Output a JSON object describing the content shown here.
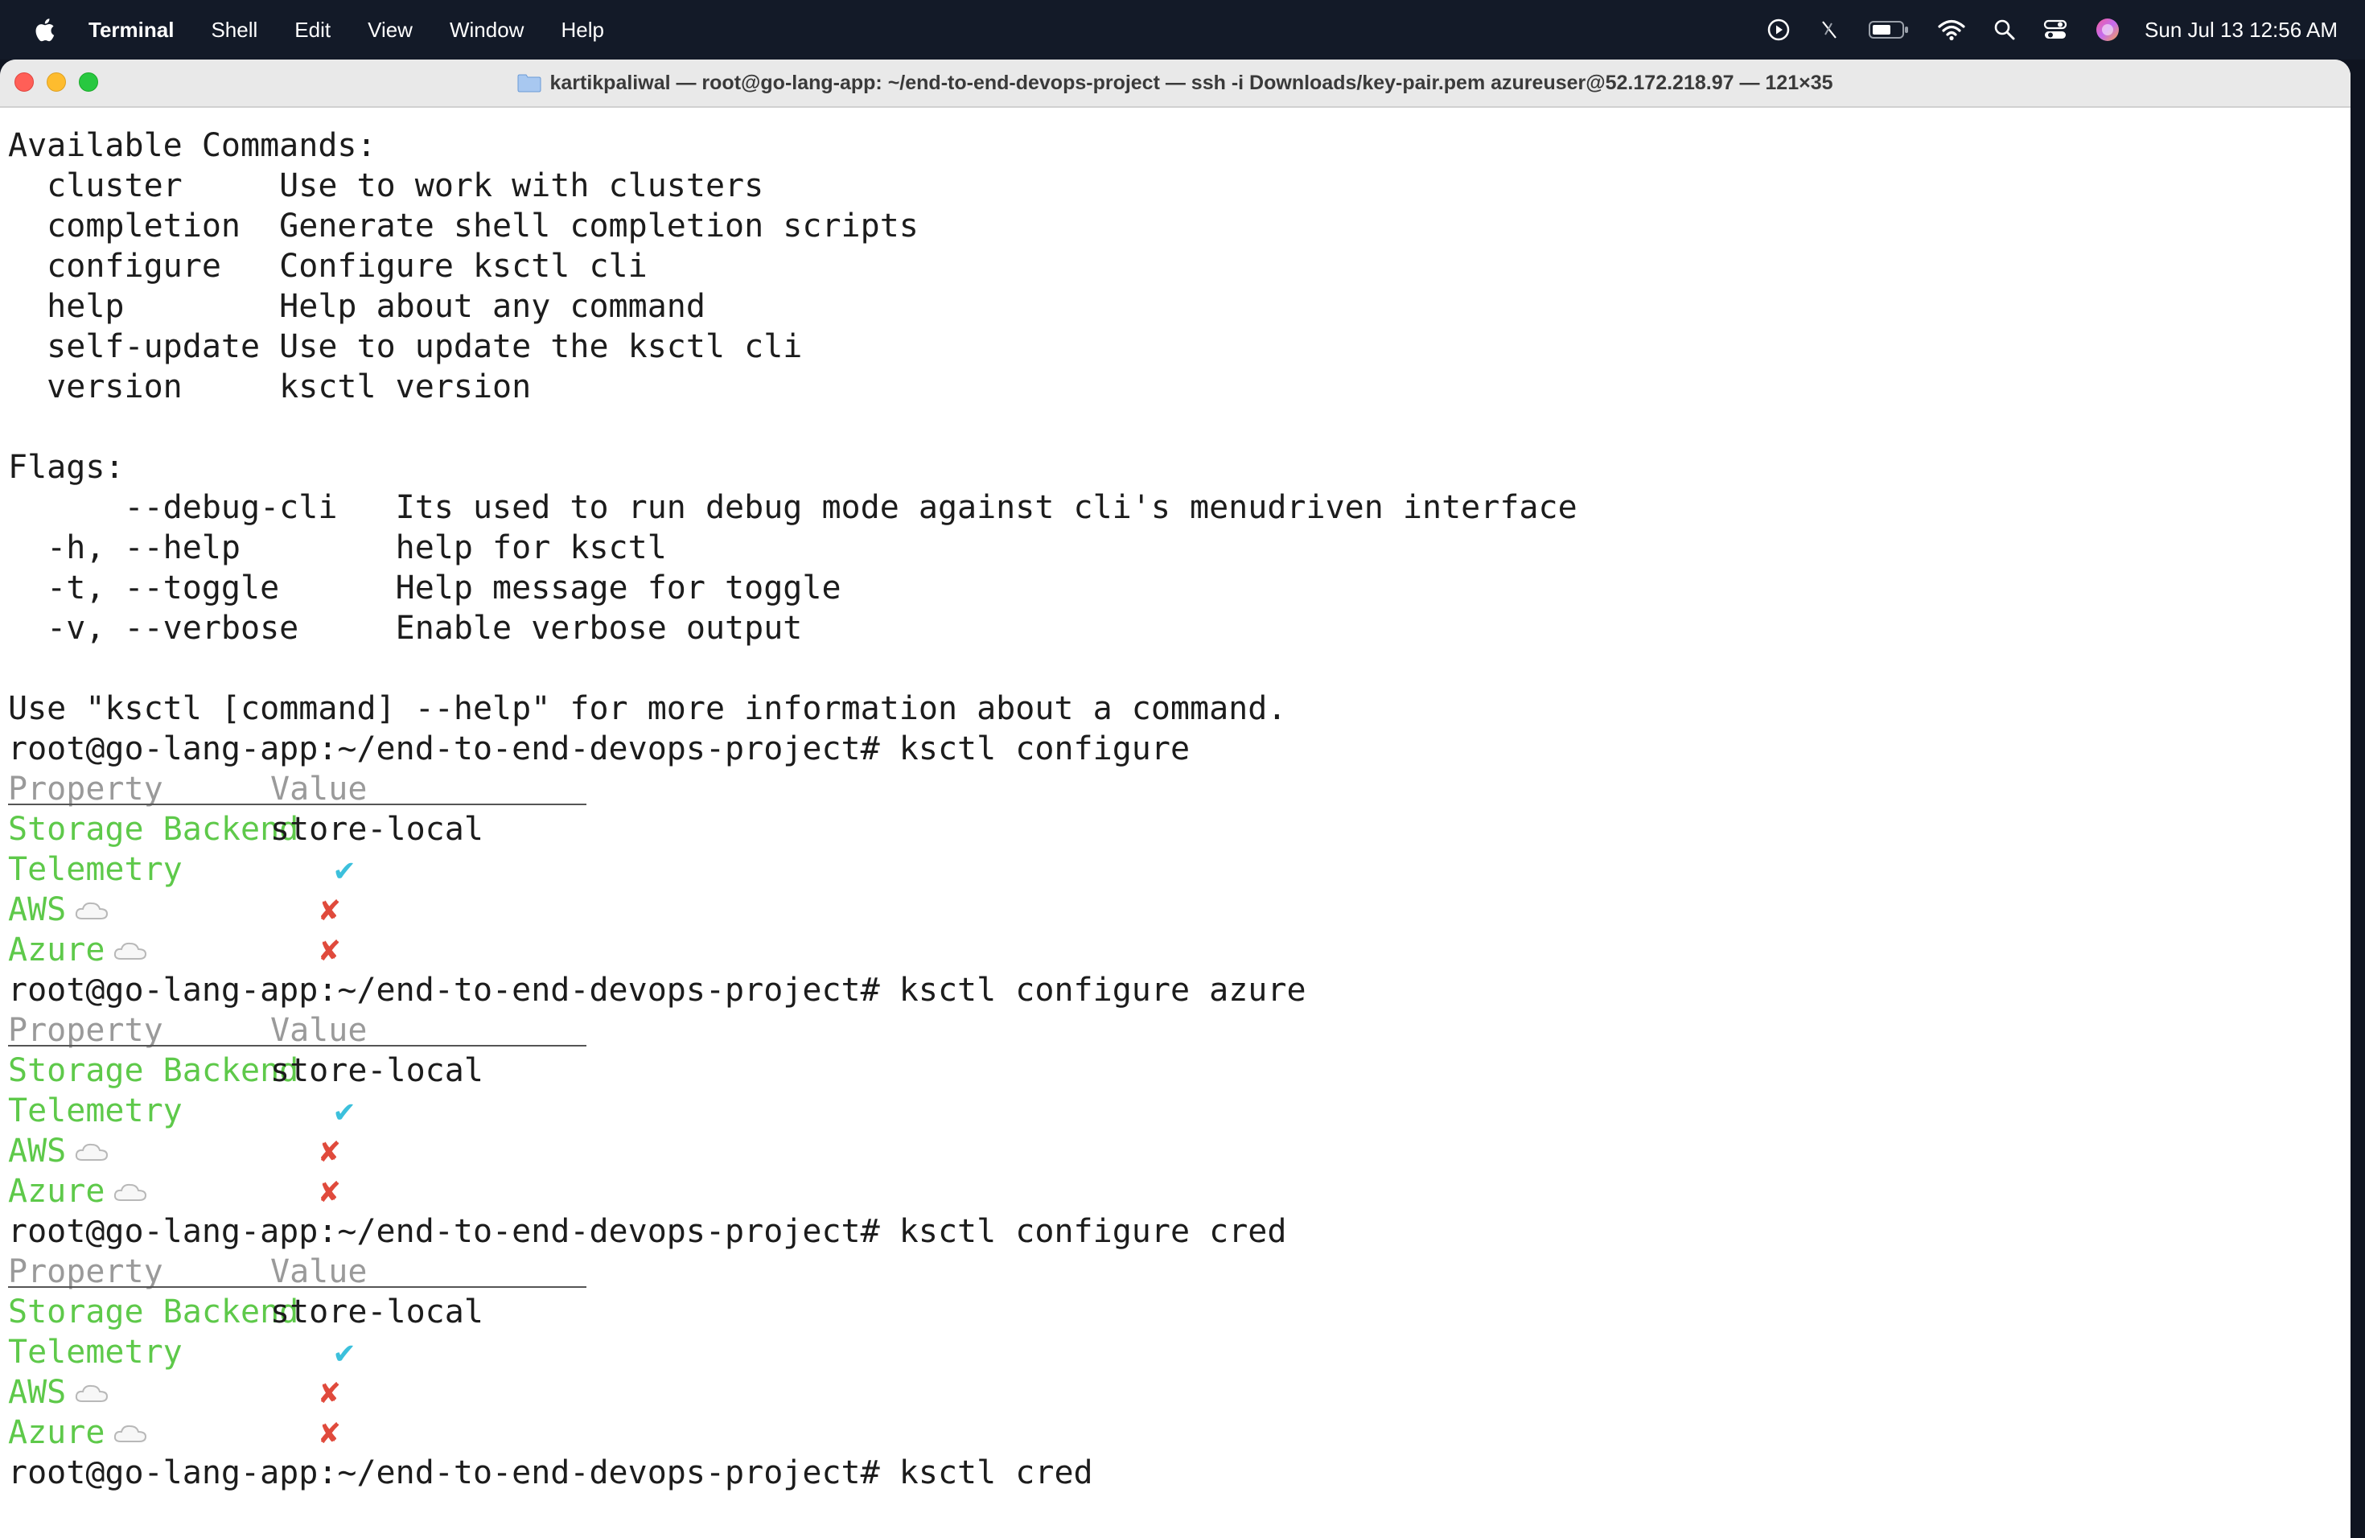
{
  "menubar": {
    "app_name": "Terminal",
    "items": [
      "Shell",
      "Edit",
      "View",
      "Window",
      "Help"
    ],
    "clock": "Sun Jul 13  12:56 AM",
    "icons": [
      "apple-icon",
      "play-circle-icon",
      "pen-slash-icon",
      "battery-icon",
      "wifi-icon",
      "search-icon",
      "control-center-icon",
      "siri-icon"
    ]
  },
  "window": {
    "title": "kartikpaliwal — root@go-lang-app: ~/end-to-end-devops-project — ssh -i Downloads/key-pair.pem azureuser@52.172.218.97 — 121×35"
  },
  "terminal": {
    "help": {
      "available_header": "Available Commands:",
      "commands": [
        {
          "name": "  cluster     ",
          "desc": "Use to work with clusters"
        },
        {
          "name": "  completion  ",
          "desc": "Generate shell completion scripts"
        },
        {
          "name": "  configure   ",
          "desc": "Configure ksctl cli"
        },
        {
          "name": "  help        ",
          "desc": "Help about any command"
        },
        {
          "name": "  self-update ",
          "desc": "Use to update the ksctl cli"
        },
        {
          "name": "  version     ",
          "desc": "ksctl version"
        }
      ],
      "flags_header": "Flags:",
      "flags": [
        {
          "name": "      --debug-cli   ",
          "desc": "Its used to run debug mode against cli's menudriven interface"
        },
        {
          "name": "  -h, --help        ",
          "desc": "help for ksctl"
        },
        {
          "name": "  -t, --toggle      ",
          "desc": "Help message for toggle"
        },
        {
          "name": "  -v, --verbose     ",
          "desc": "Enable verbose output"
        }
      ],
      "footer": "Use \"ksctl [command] --help\" for more information about a command."
    },
    "prompt": "root@go-lang-app:~/end-to-end-devops-project#",
    "blocks": [
      {
        "command": "ksctl configure"
      },
      {
        "command": "ksctl configure azure"
      },
      {
        "command": "ksctl configure cred"
      }
    ],
    "table": {
      "col_property": "Property",
      "col_value": "Value",
      "storage_label": "Storage Backend",
      "storage_value": "store-local",
      "telemetry_label": "Telemetry",
      "telemetry_value": "✔",
      "aws_label": "AWS",
      "aws_value": "✘",
      "azure_label": "Azure",
      "azure_value": "✘"
    },
    "last_command": "ksctl cred"
  }
}
